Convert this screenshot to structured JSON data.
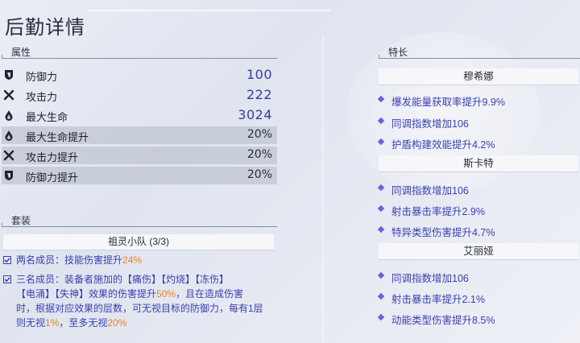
{
  "page": {
    "title": "后勤详情"
  },
  "attributes": {
    "header": "属性",
    "rows": [
      {
        "icon": "shield-icon",
        "name": "防御力",
        "value": "100",
        "shaded": false
      },
      {
        "icon": "crossed-swords-icon",
        "name": "攻击力",
        "value": "222",
        "shaded": false
      },
      {
        "icon": "drop-icon",
        "name": "最大生命",
        "value": "3024",
        "shaded": false
      },
      {
        "icon": "drop-plus-icon",
        "name": "最大生命提升",
        "value": "20%",
        "shaded": true
      },
      {
        "icon": "crossed-swords-icon",
        "name": "攻击力提升",
        "value": "20%",
        "shaded": true
      },
      {
        "icon": "shield-icon",
        "name": "防御力提升",
        "value": "20%",
        "shaded": true
      }
    ]
  },
  "set": {
    "header": "套装",
    "title": "祖灵小队 (3/3)",
    "two_piece": {
      "prefix": "两名成员：技能伤害提升",
      "value": "24%"
    },
    "three_piece": {
      "line1": "三名成员：装备者施加的【痛伤】【灼烧】【冻伤】",
      "line2_a": "【电涌】【失神】效果的伤害提升",
      "line2_value": "50%",
      "line2_b": "，且在造成伤害",
      "line3": "时，根据对应效果的层数，可无视目标的防御力，每有1层",
      "line4_a": "则无视",
      "line4_value1": "1%",
      "line4_b": "，至多无视",
      "line4_value2": "20%"
    }
  },
  "specialty": {
    "header": "特长",
    "members": [
      {
        "name": "穆希娜",
        "items": [
          "爆发能量获取率提升9.9%",
          "同调指数增加106",
          "护盾构建效能提升4.2%"
        ]
      },
      {
        "name": "斯卡特",
        "items": [
          "同调指数增加106",
          "射击暴击率提升2.9%",
          "特异类型伤害提升4.7%"
        ]
      },
      {
        "name": "艾丽娅",
        "items": [
          "同调指数增加106",
          "射击暴击率提升2.1%",
          "动能类型伤害提升8.5%"
        ]
      }
    ]
  },
  "colors": {
    "accent_text": "#3a3fb0",
    "highlight": "#e98223",
    "value_text": "#3c3b9c"
  }
}
